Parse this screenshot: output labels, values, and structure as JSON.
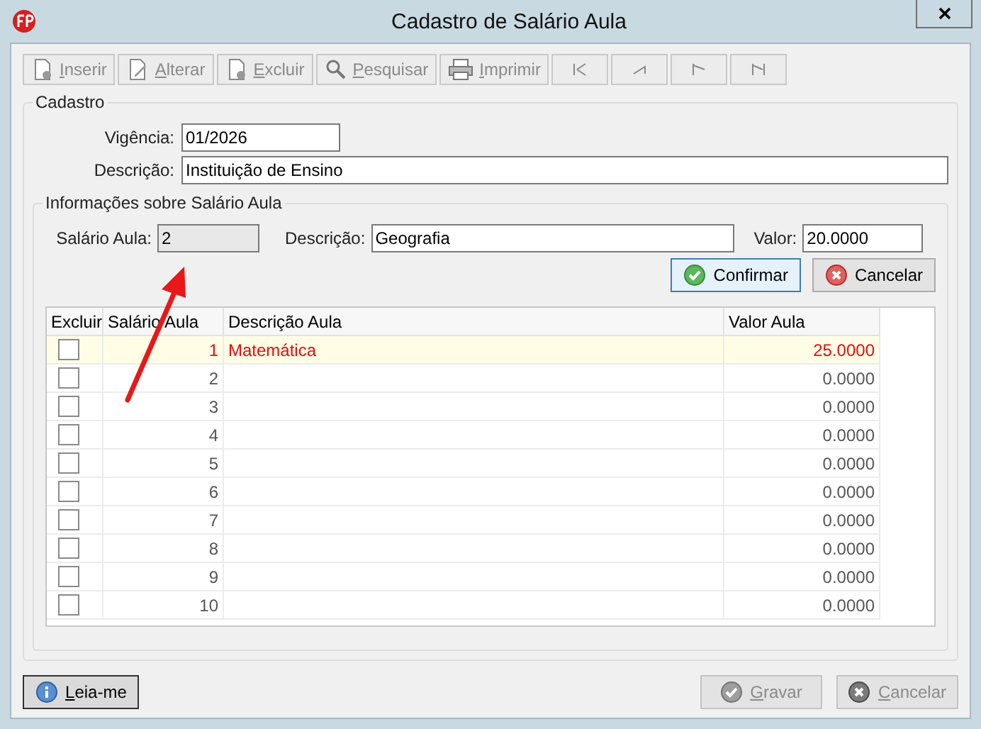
{
  "window": {
    "title": "Cadastro de Salário Aula"
  },
  "toolbar": [
    {
      "label": "Inserir",
      "kind": "insert",
      "disabled": true
    },
    {
      "label": "Alterar",
      "kind": "edit",
      "disabled": true
    },
    {
      "label": "Excluir",
      "kind": "delete",
      "disabled": true
    },
    {
      "label": "Pesquisar",
      "kind": "search",
      "disabled": true
    },
    {
      "label": "Imprimir",
      "kind": "print",
      "disabled": true
    },
    {
      "kind": "first",
      "disabled": true
    },
    {
      "kind": "prev",
      "disabled": true
    },
    {
      "kind": "next",
      "disabled": true
    },
    {
      "kind": "last",
      "disabled": true
    }
  ],
  "cadastro": {
    "title": "Cadastro",
    "vigencia_label": "Vigência:",
    "vigencia": "01/2026",
    "descricao_label": "Descrição:",
    "descricao": "Instituição de Ensino"
  },
  "info": {
    "title": "Informações sobre Salário Aula",
    "salario_label": "Salário Aula:",
    "salario": "2",
    "descricao_label": "Descrição:",
    "descricao": "Geografia",
    "valor_label": "Valor:",
    "valor": "20.0000",
    "buttons": [
      {
        "label": "Confirmar",
        "kind": "ok",
        "focused": true
      },
      {
        "label": "Cancelar",
        "kind": "cancel",
        "focused": false
      }
    ]
  },
  "table": {
    "columns": [
      "Excluir",
      "Salário Aula",
      "Descrição Aula",
      "Valor Aula"
    ],
    "rows": [
      {
        "checked": false,
        "selected": true,
        "salario": "1",
        "descricao": "Matemática",
        "valor": "25.0000"
      },
      {
        "checked": false,
        "selected": false,
        "salario": "2",
        "valor": "0.0000"
      },
      {
        "checked": false,
        "selected": false,
        "salario": "3",
        "valor": "0.0000"
      },
      {
        "checked": false,
        "selected": false,
        "salario": "4",
        "valor": "0.0000"
      },
      {
        "checked": false,
        "selected": false,
        "salario": "5",
        "valor": "0.0000"
      },
      {
        "checked": false,
        "selected": false,
        "salario": "6",
        "valor": "0.0000"
      },
      {
        "checked": false,
        "selected": false,
        "salario": "7",
        "valor": "0.0000"
      },
      {
        "checked": false,
        "selected": false,
        "salario": "8",
        "valor": "0.0000"
      },
      {
        "checked": false,
        "selected": false,
        "salario": "9",
        "valor": "0.0000"
      },
      {
        "checked": false,
        "selected": false,
        "salario": "10",
        "valor": "0.0000"
      }
    ]
  },
  "footer": [
    {
      "label": "Leia-me",
      "kind": "info",
      "disabled": false
    },
    {
      "label": "Gravar",
      "kind": "ok",
      "disabled": true
    },
    {
      "label": "Cancelar",
      "kind": "cancel",
      "disabled": true
    }
  ]
}
